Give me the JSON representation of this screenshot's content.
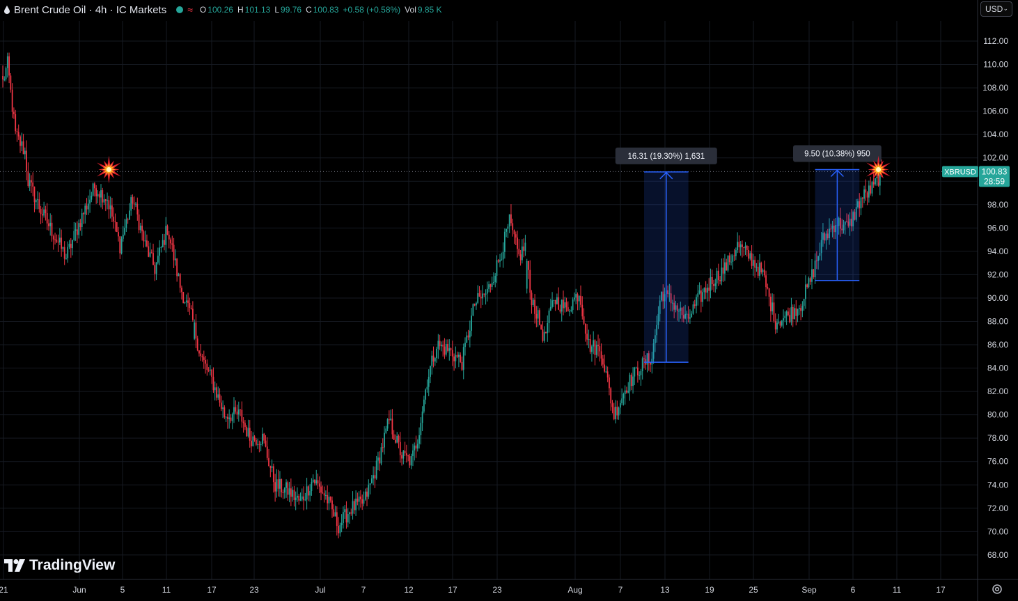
{
  "header": {
    "title": "Brent Crude Oil · 4h · IC Markets",
    "ohlc": [
      {
        "label": "O",
        "value": "100.26"
      },
      {
        "label": "H",
        "value": "101.13"
      },
      {
        "label": "L",
        "value": "99.76"
      },
      {
        "label": "C",
        "value": "100.83"
      },
      {
        "label": "",
        "value": "+0.58 (+0.58%)"
      },
      {
        "label": "Vol",
        "value": "9.85 K"
      }
    ],
    "up_color": "#26a69a",
    "down_color": "#f23645"
  },
  "currency": "USD",
  "branding": "TradingView",
  "chart_data": {
    "type": "candlestick",
    "symbol": "XBRUSD",
    "timeframe": "4h",
    "ylim": [
      66.5,
      113.8
    ],
    "y_ticks": [
      "112.00",
      "110.00",
      "108.00",
      "106.00",
      "104.00",
      "102.00",
      "98.00",
      "96.00",
      "94.00",
      "92.00",
      "90.00",
      "88.00",
      "86.00",
      "84.00",
      "82.00",
      "80.00",
      "78.00",
      "76.00",
      "74.00",
      "72.00",
      "70.00",
      "68.00"
    ],
    "x_ticks": [
      "21",
      "Jun",
      "5",
      "11",
      "17",
      "23",
      "Jul",
      "7",
      "12",
      "17",
      "23",
      "Aug",
      "7",
      "13",
      "19",
      "25",
      "Sep",
      "6",
      "11",
      "17"
    ],
    "last_price": {
      "value": "100.83",
      "countdown": "28:59",
      "symbol": "XBRUSD",
      "color": "#26a69a"
    },
    "anchors": [
      {
        "i": 0,
        "y": 108.5
      },
      {
        "i": 3,
        "y": 110
      },
      {
        "i": 8,
        "y": 104
      },
      {
        "i": 14,
        "y": 102.5
      },
      {
        "i": 16,
        "y": 100
      },
      {
        "i": 24,
        "y": 97.5
      },
      {
        "i": 34,
        "y": 95
      },
      {
        "i": 40,
        "y": 93.5
      },
      {
        "i": 50,
        "y": 97
      },
      {
        "i": 58,
        "y": 99.5
      },
      {
        "i": 66,
        "y": 98.5
      },
      {
        "i": 74,
        "y": 94.5
      },
      {
        "i": 82,
        "y": 98.5
      },
      {
        "i": 90,
        "y": 94.5
      },
      {
        "i": 96,
        "y": 92.5
      },
      {
        "i": 104,
        "y": 96
      },
      {
        "i": 112,
        "y": 91
      },
      {
        "i": 120,
        "y": 88
      },
      {
        "i": 125,
        "y": 85
      },
      {
        "i": 132,
        "y": 83
      },
      {
        "i": 140,
        "y": 80
      },
      {
        "i": 150,
        "y": 80
      },
      {
        "i": 156,
        "y": 78
      },
      {
        "i": 164,
        "y": 78
      },
      {
        "i": 172,
        "y": 74
      },
      {
        "i": 180,
        "y": 73.5
      },
      {
        "i": 188,
        "y": 72.5
      },
      {
        "i": 196,
        "y": 74.5
      },
      {
        "i": 204,
        "y": 73
      },
      {
        "i": 212,
        "y": 70.5
      },
      {
        "i": 220,
        "y": 72
      },
      {
        "i": 228,
        "y": 72.5
      },
      {
        "i": 236,
        "y": 75.5
      },
      {
        "i": 244,
        "y": 79.5
      },
      {
        "i": 252,
        "y": 76.5
      },
      {
        "i": 258,
        "y": 76
      },
      {
        "i": 262,
        "y": 78
      },
      {
        "i": 268,
        "y": 83
      },
      {
        "i": 274,
        "y": 86
      },
      {
        "i": 282,
        "y": 85.5
      },
      {
        "i": 290,
        "y": 84.5
      },
      {
        "i": 298,
        "y": 89.5
      },
      {
        "i": 306,
        "y": 90.5
      },
      {
        "i": 314,
        "y": 93.5
      },
      {
        "i": 320,
        "y": 96.5
      },
      {
        "i": 326,
        "y": 93.5
      },
      {
        "i": 330,
        "y": 94.5
      },
      {
        "i": 333,
        "y": 90.5
      },
      {
        "i": 342,
        "y": 86.5
      },
      {
        "i": 348,
        "y": 90
      },
      {
        "i": 356,
        "y": 89
      },
      {
        "i": 364,
        "y": 90.5
      },
      {
        "i": 370,
        "y": 86
      },
      {
        "i": 378,
        "y": 85.5
      },
      {
        "i": 386,
        "y": 80
      },
      {
        "i": 394,
        "y": 82.5
      },
      {
        "i": 402,
        "y": 84
      },
      {
        "i": 410,
        "y": 85
      },
      {
        "i": 416,
        "y": 90.5
      },
      {
        "i": 424,
        "y": 89.5
      },
      {
        "i": 432,
        "y": 88
      },
      {
        "i": 440,
        "y": 90
      },
      {
        "i": 448,
        "y": 91.5
      },
      {
        "i": 456,
        "y": 92.5
      },
      {
        "i": 464,
        "y": 94.5
      },
      {
        "i": 472,
        "y": 93.5
      },
      {
        "i": 480,
        "y": 92
      },
      {
        "i": 488,
        "y": 88
      },
      {
        "i": 496,
        "y": 88.5
      },
      {
        "i": 504,
        "y": 89.5
      },
      {
        "i": 510,
        "y": 91.5
      },
      {
        "i": 518,
        "y": 95
      },
      {
        "i": 526,
        "y": 96.5
      },
      {
        "i": 534,
        "y": 96
      },
      {
        "i": 542,
        "y": 98.5
      },
      {
        "i": 550,
        "y": 99.5
      },
      {
        "i": 555,
        "y": 100.83
      }
    ],
    "gaps": [
      {
        "after": 120,
        "start": 86.5
      },
      {
        "after": 330,
        "start": 90.8
      }
    ],
    "measurements": [
      {
        "label": "16.31 (19.30%) 1,631",
        "from_i": 405,
        "to_i": 433,
        "low": 84.5,
        "high": 100.8
      },
      {
        "label": "9.50 (10.38%) 950",
        "from_i": 513,
        "to_i": 541,
        "low": 91.5,
        "high": 101.0
      }
    ],
    "markers": [
      {
        "name": "explosion-marker-left",
        "i": 67,
        "y": 101.0
      },
      {
        "name": "explosion-marker-right",
        "i": 553,
        "y": 101.0
      }
    ],
    "grid": true
  }
}
